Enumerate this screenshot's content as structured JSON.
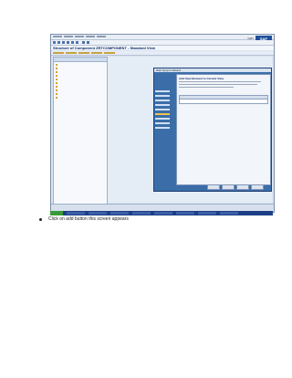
{
  "screenshot": {
    "window_title": "Structure of Component ZRTCOMPONENT - Standard View",
    "sap_logo": "SAP",
    "dialog_title": "Web Dynpro Wizard",
    "dialog_heading": "Add View Element to Current View",
    "status_time": "GMT"
  },
  "caption": {
    "text": "Click on add button this screen appears"
  }
}
